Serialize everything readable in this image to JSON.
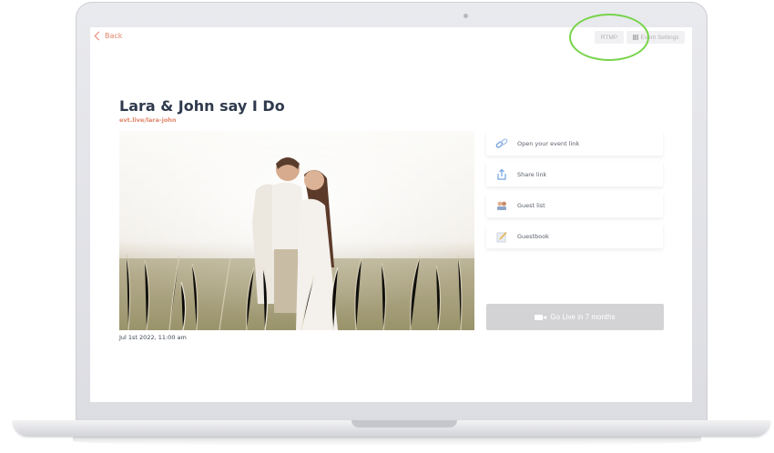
{
  "nav": {
    "back_label": "Back"
  },
  "toolbar": {
    "rtmp_label": "RTMP",
    "settings_label": "Event Settings"
  },
  "event": {
    "title": "Lara & John say I Do",
    "link": "evt.live/lara-john",
    "date": "Jul 1st 2022, 11:00 am"
  },
  "actions": [
    {
      "label": "Open your event link",
      "icon": "link-icon"
    },
    {
      "label": "Share link",
      "icon": "share-icon"
    },
    {
      "label": "Guest list",
      "icon": "guests-icon"
    },
    {
      "label": "Guestbook",
      "icon": "guestbook-icon"
    }
  ],
  "go_live": {
    "label": "Go Live in 7 months",
    "icon": "video-camera-icon"
  },
  "colors": {
    "accent": "#e0846a",
    "title": "#2f3a4d",
    "highlight": "#78d44b",
    "disabled": "#d3d3d6"
  }
}
